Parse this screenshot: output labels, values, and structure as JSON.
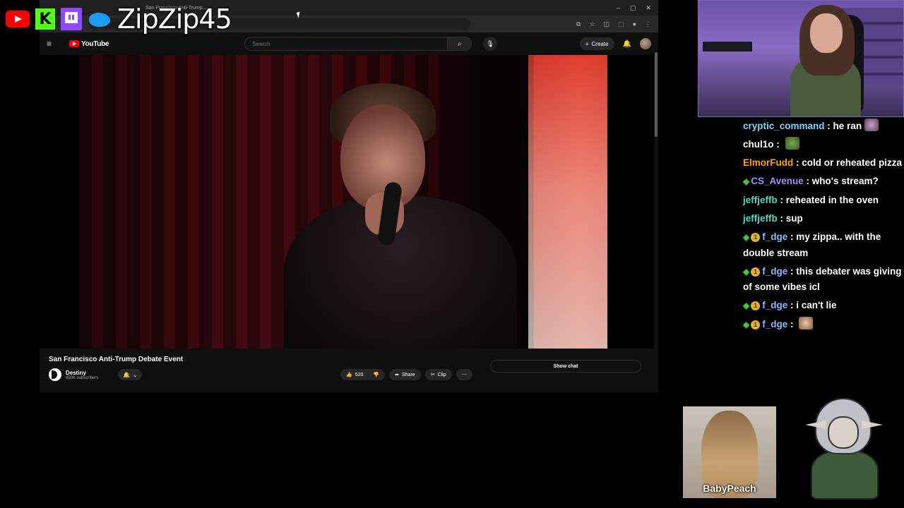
{
  "overlay": {
    "handle": "ZipZip45",
    "socials": [
      {
        "name": "youtube-icon"
      },
      {
        "name": "kick-icon",
        "glyph": "K"
      },
      {
        "name": "twitch-icon"
      },
      {
        "name": "twitter-icon"
      }
    ]
  },
  "browser": {
    "tab_title": "San Francisco Anti-Trump...",
    "window_controls": [
      "–",
      "▢",
      "✕"
    ]
  },
  "youtube": {
    "logo_text": "YouTube",
    "search_placeholder": "Search",
    "create_label": "Create",
    "video_title": "San Francisco Anti-Trump Debate Event",
    "channel_name": "Destiny",
    "subscribers": "850K subscribers",
    "like_count": "520",
    "share_label": "Share",
    "clip_label": "Clip",
    "show_chat_label": "Show chat"
  },
  "chat": {
    "messages": [
      {
        "user": "cryptic_command",
        "color": "#7fd3ff",
        "text": "he ran",
        "badges": [],
        "emote": "emote-1"
      },
      {
        "user": "chul1o",
        "color": "#ffffff",
        "text": "",
        "badges": [],
        "emote": "emote-2"
      },
      {
        "user": "ElmorFudd",
        "color": "#ff9f1a",
        "text": "cold or reheated pizza",
        "badges": []
      },
      {
        "user": "CS_Avenue",
        "color": "#9f8fff",
        "text": "who's stream?",
        "badges": [
          "diamond"
        ]
      },
      {
        "user": "jeffjeffb",
        "color": "#4fd8c4",
        "text": "reheated in the oven",
        "badges": []
      },
      {
        "user": "jeffjeffb",
        "color": "#4fd8c4",
        "text": "sup",
        "badges": []
      },
      {
        "user": "f_dge",
        "color": "#8fb8ff",
        "text": "my zippa.. with the double stream",
        "badges": [
          "diamond",
          "coin"
        ]
      },
      {
        "user": "f_dge",
        "color": "#8fb8ff",
        "text": "this debater was giving of some vibes icl",
        "badges": [
          "diamond",
          "coin"
        ]
      },
      {
        "user": "f_dge",
        "color": "#8fb8ff",
        "text": "i can't lie",
        "badges": [
          "diamond",
          "coin"
        ]
      },
      {
        "user": "f_dge",
        "color": "#8fb8ff",
        "text": "",
        "badges": [
          "diamond",
          "coin"
        ],
        "emote": "emote-3"
      }
    ]
  },
  "tiles": {
    "peach_name": "BabyPeach"
  },
  "colors": {
    "youtube_red": "#ff0000",
    "kick_green": "#53fc18",
    "twitch_purple": "#9146ff",
    "twitter_blue": "#1d9bf0"
  }
}
